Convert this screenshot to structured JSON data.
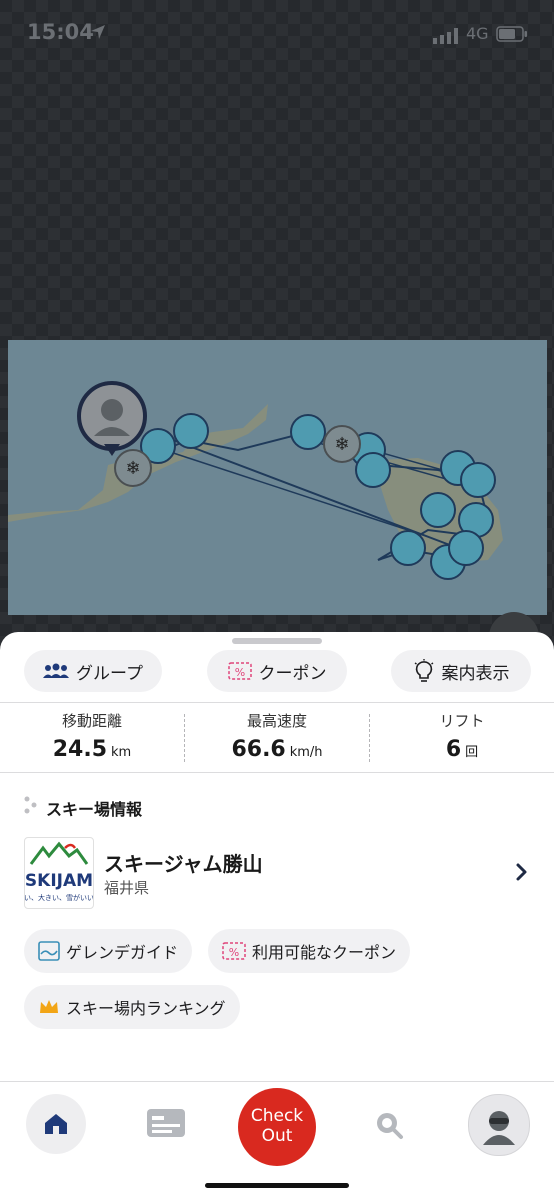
{
  "status_bar": {
    "time": "15:04",
    "network": "4G"
  },
  "map": {
    "location_icon": "location-arrow-icon"
  },
  "tabs": {
    "group": "グループ",
    "coupon": "クーポン",
    "guide": "案内表示"
  },
  "stats": {
    "distance": {
      "label": "移動距離",
      "value": "24.5",
      "unit": "km"
    },
    "speed": {
      "label": "最高速度",
      "value": "66.6",
      "unit": "km/h"
    },
    "lift": {
      "label": "リフト",
      "value": "6",
      "unit": "回"
    }
  },
  "resort_section": {
    "title": "スキー場情報"
  },
  "resort": {
    "name": "スキージャム勝山",
    "prefecture": "福井県",
    "logo_text": "SKIJAM",
    "logo_tagline": "近い、大きい、雪がいい。"
  },
  "links": {
    "gelande": "ゲレンデガイド",
    "coupons": "利用可能なクーポン",
    "ranking": "スキー場内ランキング"
  },
  "nav": {
    "checkout_line1": "Check",
    "checkout_line2": "Out"
  },
  "colors": {
    "accent_red": "#d9291f",
    "brand_navy": "#1f3a7a",
    "coupon_pink": "#e0457b",
    "crown": "#f2a516"
  }
}
